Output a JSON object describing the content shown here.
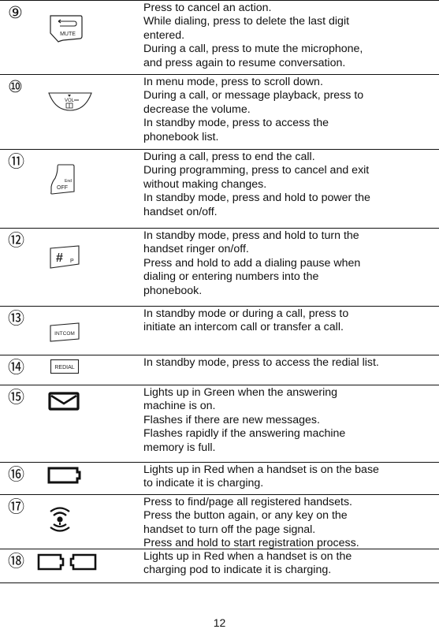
{
  "rows": [
    {
      "num": "⑨",
      "icon": "mute-back-key-icon",
      "icon_label": "MUTE",
      "lines": [
        "Press to cancel an action.",
        "While dialing, press to delete the last digit",
        "entered.",
        "During a call, press to mute the microphone,",
        "and press again to resume conversation."
      ]
    },
    {
      "num": "⑩",
      "icon": "volume-down-phonebook-key-icon",
      "icon_label": "VOL",
      "lines": [
        "In menu mode, press to scroll down.",
        "During a call, or message playback, press to",
        "decrease the volume.",
        "In standby mode, press to access the",
        "phonebook list."
      ]
    },
    {
      "num": "⑪",
      "icon": "end-off-key-icon",
      "icon_label_top": "End",
      "icon_label": "OFF",
      "lines": [
        "During a call, press to end the call.",
        "During programming, press to cancel and exit",
        "without making changes.",
        "In standby mode, press and hold to power the",
        "handset on/off."
      ]
    },
    {
      "num": "⑫",
      "icon": "hash-pause-key-icon",
      "icon_label": "#",
      "icon_label_sub": "P",
      "lines": [
        "In standby mode, press and hold to turn the",
        "handset ringer on/off.",
        "Press and hold to add a dialing pause when",
        "dialing or entering numbers into the",
        "phonebook."
      ]
    },
    {
      "num": "⑬",
      "icon": "intercom-key-icon",
      "icon_label": "INTCOM",
      "lines": [
        "In standby mode or during a call, press to",
        "initiate an intercom call or transfer a call."
      ]
    },
    {
      "num": "⑭",
      "icon": "redial-key-icon",
      "icon_label": "REDIAL",
      "lines": [
        "In standby mode, press to access the redial list."
      ]
    },
    {
      "num": "⑮",
      "icon": "message-envelope-icon",
      "lines": [
        "Lights up in Green when the answering",
        "machine is on.",
        "Flashes if there are new messages.",
        "Flashes rapidly if the answering machine",
        "memory is full."
      ]
    },
    {
      "num": "⑯",
      "icon": "battery-charging-icon",
      "lines": [
        "Lights up in Red when a handset is on the base",
        "to indicate it is charging."
      ]
    },
    {
      "num": "⑰",
      "icon": "page-find-signal-icon",
      "lines": [
        "Press to find/page all registered handsets.",
        "Press the button again, or any key on the",
        "handset to turn off the page signal.",
        "Press and hold to start registration process."
      ]
    },
    {
      "num": "⑱",
      "icon": "dual-battery-charging-icon",
      "lines": [
        "Lights up in Red when a handset is on the",
        "charging pod to indicate it is charging."
      ]
    }
  ],
  "page_number": "12"
}
